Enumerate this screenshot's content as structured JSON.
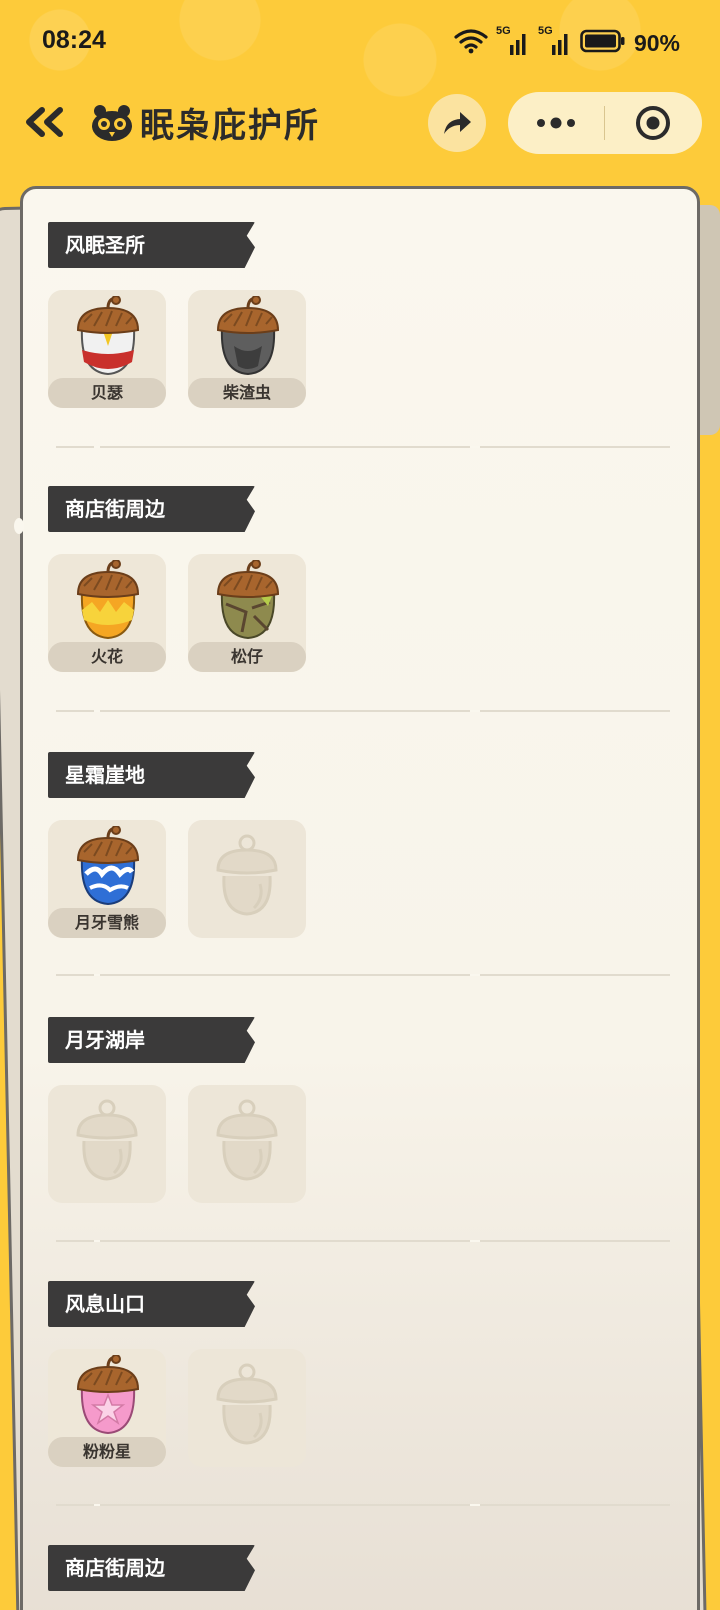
{
  "status": {
    "time": "08:24",
    "network1": "5G",
    "network2": "5G",
    "battery": "90%"
  },
  "header": {
    "title": "眠枭庇护所"
  },
  "colors": {
    "background": "#FDCB3A",
    "paper": "#FAF7EE",
    "tag": "#3B3A3A"
  },
  "sections": [
    {
      "title": "风眠圣所",
      "slots": [
        {
          "name": "贝瑟",
          "icon": "acorn-red-icon",
          "collected": true
        },
        {
          "name": "柴渣虫",
          "icon": "acorn-gray-icon",
          "collected": true
        }
      ]
    },
    {
      "title": "商店街周边",
      "slots": [
        {
          "name": "火花",
          "icon": "acorn-orange-icon",
          "collected": true
        },
        {
          "name": "松仔",
          "icon": "acorn-green-icon",
          "collected": true
        }
      ]
    },
    {
      "title": "星霜崖地",
      "slots": [
        {
          "name": "月牙雪熊",
          "icon": "acorn-blue-icon",
          "collected": true
        },
        {
          "name": "",
          "icon": "acorn-placeholder-icon",
          "collected": false
        }
      ]
    },
    {
      "title": "月牙湖岸",
      "slots": [
        {
          "name": "",
          "icon": "acorn-placeholder-icon",
          "collected": false
        },
        {
          "name": "",
          "icon": "acorn-placeholder-icon",
          "collected": false
        }
      ]
    },
    {
      "title": "风息山口",
      "slots": [
        {
          "name": "粉粉星",
          "icon": "acorn-pink-icon",
          "collected": true
        },
        {
          "name": "",
          "icon": "acorn-placeholder-icon",
          "collected": false
        }
      ]
    },
    {
      "title": "商店街周边",
      "slots": []
    }
  ]
}
